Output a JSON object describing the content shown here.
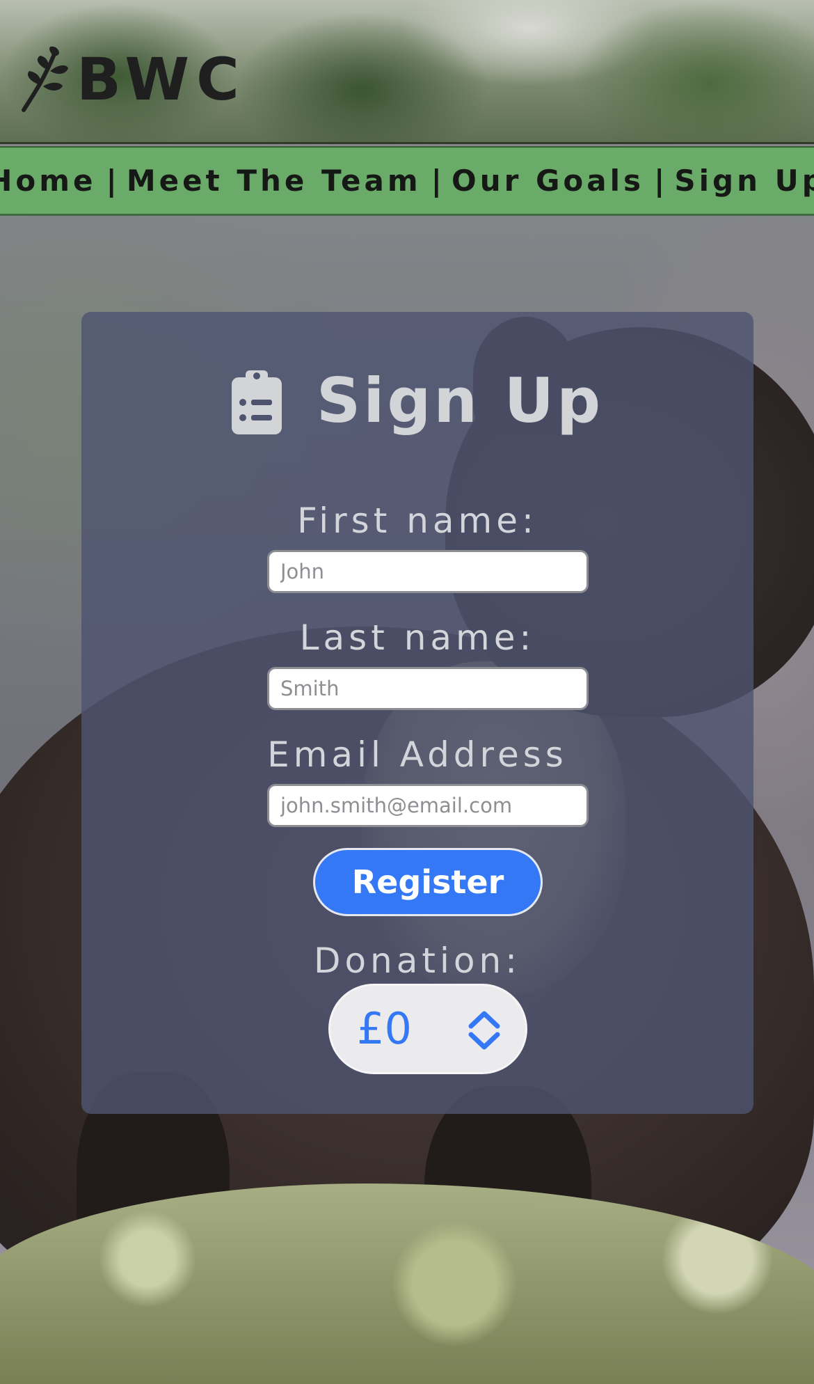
{
  "header": {
    "logo_text": "BWC",
    "logo_icon": "leaf-branch-icon"
  },
  "nav": {
    "items": [
      {
        "label": "Home"
      },
      {
        "label": "Meet The Team"
      },
      {
        "label": "Our Goals"
      },
      {
        "label": "Sign Up"
      }
    ],
    "separator": "|"
  },
  "signup": {
    "title": "Sign Up",
    "title_icon": "clipboard-list-icon",
    "first_name": {
      "label": "First name:",
      "placeholder": "John",
      "value": ""
    },
    "last_name": {
      "label": "Last name:",
      "placeholder": "Smith",
      "value": ""
    },
    "email": {
      "label": "Email Address",
      "placeholder": "john.smith@email.com",
      "value": ""
    },
    "register_label": "Register",
    "donation": {
      "label": "Donation:",
      "selected": "£0",
      "icon": "chevron-up-down-icon"
    }
  },
  "colors": {
    "nav_bg": "#6bab6a",
    "card_bg": "#4e5470",
    "button_blue": "#3478f6",
    "text_light": "#d4d5da",
    "logo_dark": "#1e1f1e"
  }
}
